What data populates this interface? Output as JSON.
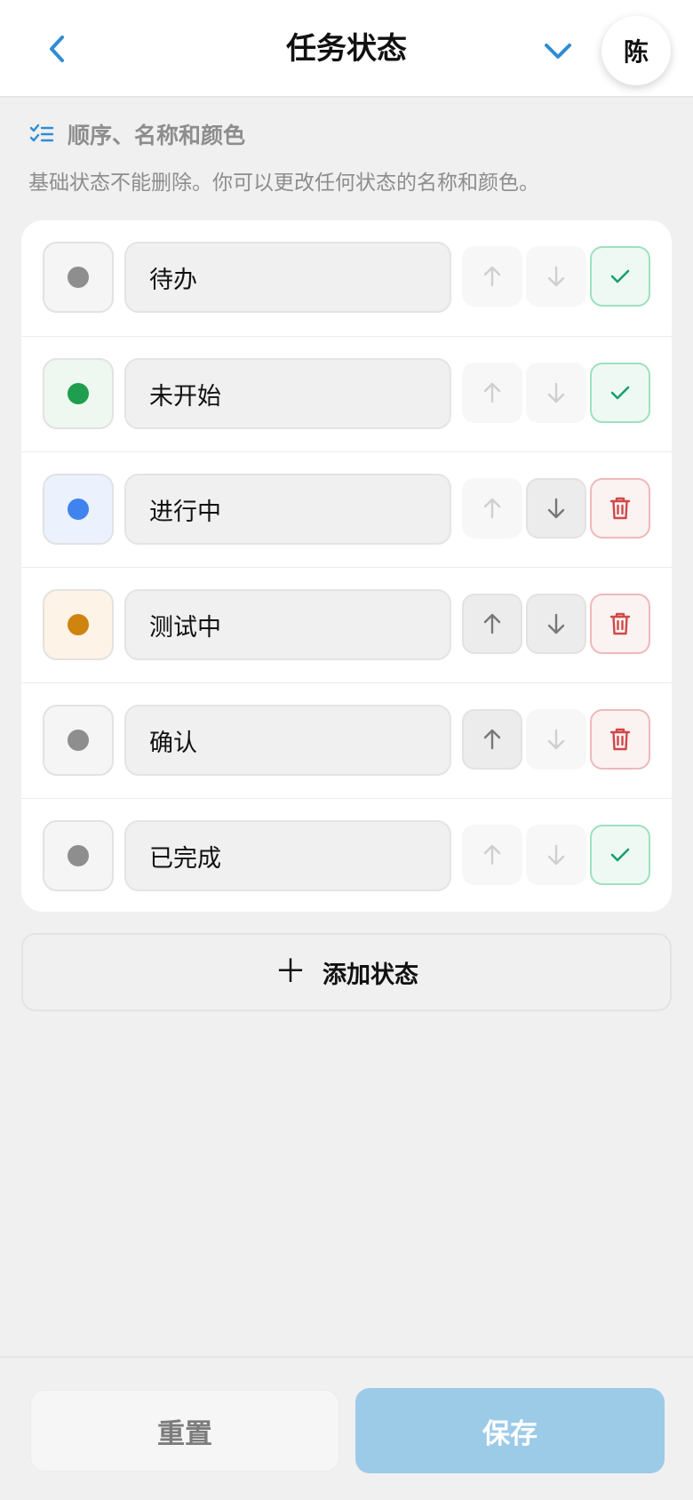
{
  "header": {
    "title": "任务状态",
    "back_icon": "chevron-left-icon",
    "dropdown_icon": "chevron-down-icon",
    "avatar_text": "陈",
    "accent_color": "#2f8dd3"
  },
  "section": {
    "icon": "checklist-icon",
    "heading": "顺序、名称和颜色",
    "description": "基础状态不能删除。你可以更改任何状态的名称和颜色。"
  },
  "statuses": [
    {
      "name": "待办",
      "color": "#8e8e8e",
      "swatch_bg": "#f5f5f5",
      "up_enabled": false,
      "down_enabled": false,
      "action": "check"
    },
    {
      "name": "未开始",
      "color": "#1e9e4e",
      "swatch_bg": "#eef8f0",
      "up_enabled": false,
      "down_enabled": false,
      "action": "check"
    },
    {
      "name": "进行中",
      "color": "#3f84ee",
      "swatch_bg": "#ecf2fd",
      "up_enabled": false,
      "down_enabled": true,
      "action": "delete"
    },
    {
      "name": "测试中",
      "color": "#cf8410",
      "swatch_bg": "#fdf3e6",
      "up_enabled": true,
      "down_enabled": true,
      "action": "delete"
    },
    {
      "name": "确认",
      "color": "#8e8e8e",
      "swatch_bg": "#f5f5f5",
      "up_enabled": true,
      "down_enabled": false,
      "action": "delete"
    },
    {
      "name": "已完成",
      "color": "#8e8e8e",
      "swatch_bg": "#f5f5f5",
      "up_enabled": false,
      "down_enabled": false,
      "action": "check"
    }
  ],
  "add_button": {
    "icon": "plus-icon",
    "plus_glyph": "＋",
    "label": "添加状态"
  },
  "footer": {
    "reset_label": "重置",
    "save_label": "保存",
    "save_color": "#9ccbe8"
  },
  "colors": {
    "check": "#16a06a",
    "delete": "#d04848",
    "arrow_enabled": "#777777",
    "arrow_disabled": "#cfcfcf"
  }
}
